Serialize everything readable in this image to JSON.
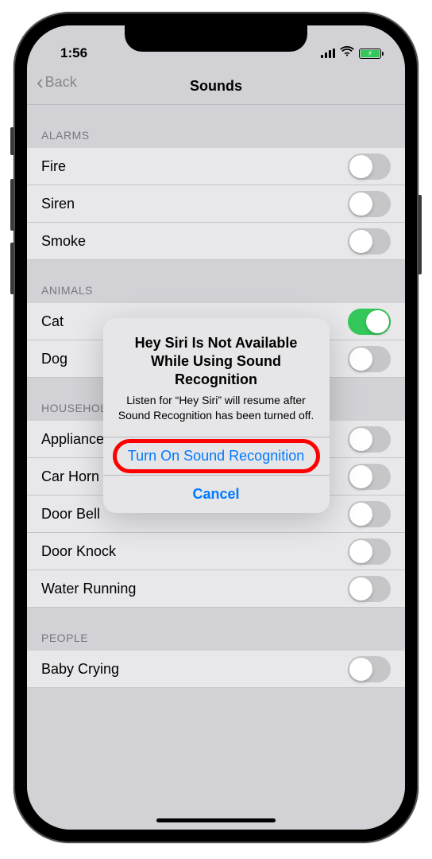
{
  "status": {
    "time": "1:56"
  },
  "nav": {
    "back_label": "Back",
    "title": "Sounds"
  },
  "sections": [
    {
      "header": "ALARMS",
      "items": [
        {
          "label": "Fire",
          "on": false
        },
        {
          "label": "Siren",
          "on": false
        },
        {
          "label": "Smoke",
          "on": false
        }
      ]
    },
    {
      "header": "ANIMALS",
      "items": [
        {
          "label": "Cat",
          "on": true
        },
        {
          "label": "Dog",
          "on": false
        }
      ]
    },
    {
      "header": "HOUSEHOLD",
      "items": [
        {
          "label": "Appliances",
          "on": false
        },
        {
          "label": "Car Horn",
          "on": false
        },
        {
          "label": "Door Bell",
          "on": false
        },
        {
          "label": "Door Knock",
          "on": false
        },
        {
          "label": "Water Running",
          "on": false
        }
      ]
    },
    {
      "header": "PEOPLE",
      "items": [
        {
          "label": "Baby Crying",
          "on": false
        }
      ]
    }
  ],
  "alert": {
    "title": "Hey Siri Is Not Available While Using Sound Recognition",
    "message": "Listen for “Hey Siri” will resume after Sound Recognition has been turned off.",
    "confirm": "Turn On Sound Recognition",
    "cancel": "Cancel"
  }
}
